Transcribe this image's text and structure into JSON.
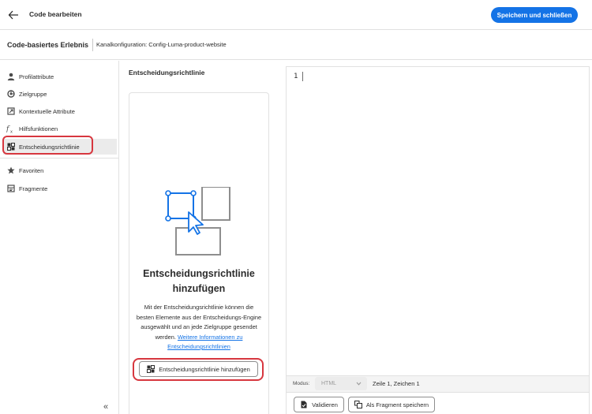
{
  "header": {
    "title": "Code bearbeiten",
    "primary_button": "Speichern und schließen",
    "accent": "#1473e6"
  },
  "subheader": {
    "title": "Code-basiertes Erlebnis",
    "channel_config": "Kanalkonfiguration: Config-Luma-product-website"
  },
  "sidebar": {
    "items": [
      {
        "label": "Profilattribute",
        "icon": "user-icon"
      },
      {
        "label": "Zielgruppe",
        "icon": "audience-icon"
      },
      {
        "label": "Kontextuelle Attribute",
        "icon": "contextual-icon"
      },
      {
        "label": "Hilfsfunktionen",
        "icon": "function-icon"
      },
      {
        "label": "Entscheidungsrichtlinie",
        "icon": "decision-policy-icon",
        "active": true
      },
      {
        "label": "Favoriten",
        "icon": "star-icon"
      },
      {
        "label": "Fragmente",
        "icon": "fragment-icon"
      }
    ],
    "collapse_label": "«",
    "highlight_color": "#d7373f"
  },
  "panel": {
    "title": "Entscheidungsrichtlinie",
    "heading": "Entscheidungsrichtlinie hinzufügen",
    "description": "Mit der Entscheidungsrichtlinie können die besten Elemente aus der Entscheidungs-Engine ausgewählt und an jede Zielgruppe gesendet werden.",
    "link_text": "Weitere Informationen zu Entscheidungsrichtlinien",
    "add_button": "Entscheidungsrichtlinie hinzufügen"
  },
  "editor": {
    "line_number": "1",
    "mode_label": "Modus:",
    "mode_value": "HTML",
    "cursor_position": "Zeile 1, Zeichen 1",
    "validate_button": "Validieren",
    "save_fragment_button": "Als Fragment speichern"
  }
}
